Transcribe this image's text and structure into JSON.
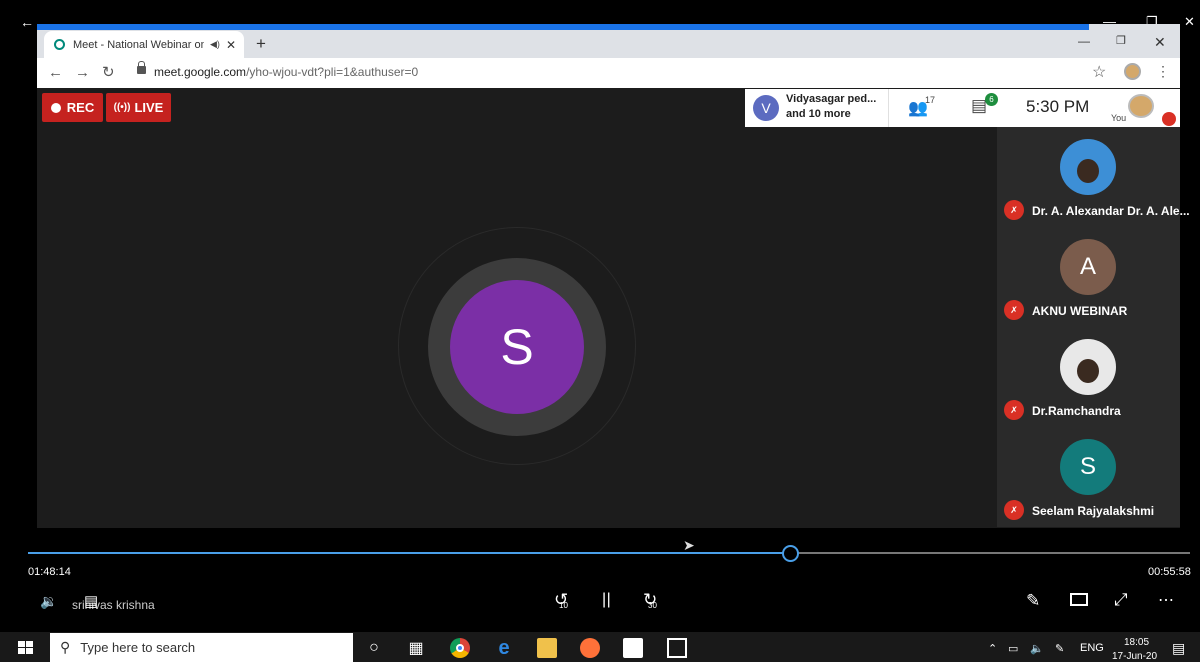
{
  "player": {
    "elapsed": "01:48:14",
    "duration": "00:55:58",
    "progress_fraction": 0.655,
    "subtitle_overlay": "srinivas krishna",
    "rewind_seconds": "10",
    "forward_seconds": "30"
  },
  "browser": {
    "tab_title": "Meet - National Webinar on",
    "url_domain": "meet.google.com",
    "url_path": "/yho-wjou-vdt?pli=1&authuser=0"
  },
  "meet": {
    "rec_label": "REC",
    "live_label": "LIVE",
    "presenter_initial": "V",
    "presenter_line1": "Vidyasagar ped...",
    "presenter_line2": "and 10 more",
    "participant_count": "17",
    "chat_badge": "6",
    "time": "5:30 PM",
    "self_label": "You",
    "main_speaker_initial": "S",
    "participants": [
      {
        "name": "Dr. A. Alexandar Dr. A. Ale...",
        "initial": ""
      },
      {
        "name": "AKNU WEBINAR",
        "initial": "A"
      },
      {
        "name": "Dr.Ramchandra",
        "initial": ""
      },
      {
        "name": "Seelam Rajyalakshmi",
        "initial": "S"
      }
    ],
    "colors": {
      "record_red": "#c5221f",
      "main_avatar": "#7b2fa6",
      "teal_avatar": "#137b7b",
      "seek_blue": "#4a9fe8"
    }
  },
  "taskbar": {
    "search_placeholder": "Type here to search",
    "language": "ENG",
    "clock_time": "18:05",
    "clock_date": "17-Jun-20"
  }
}
